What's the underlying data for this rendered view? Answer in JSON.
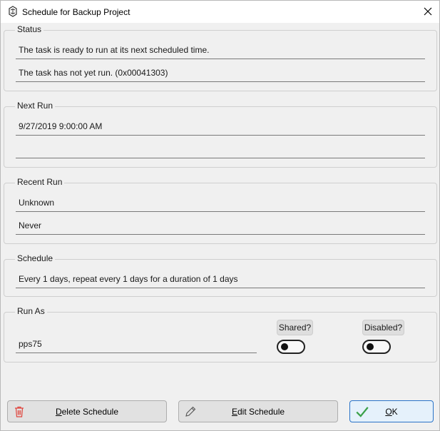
{
  "window": {
    "title": "Schedule for Backup Project"
  },
  "status": {
    "legend": "Status",
    "message": "The task is ready to run at its next scheduled time.",
    "result": "The task has not yet run. (0x00041303)"
  },
  "next_run": {
    "legend": "Next Run",
    "time": "9/27/2019 9:00:00 AM",
    "extra": ""
  },
  "recent_run": {
    "legend": "Recent Run",
    "result": "Unknown",
    "time": "Never"
  },
  "schedule": {
    "legend": "Schedule",
    "description": "Every 1 days, repeat every 1 days for a duration of 1 days"
  },
  "run_as": {
    "legend": "Run As",
    "user": "pps75",
    "shared_label": "Shared?",
    "shared_value": false,
    "disabled_label": "Disabled?",
    "disabled_value": false
  },
  "buttons": {
    "delete_prefix": "D",
    "delete_rest": "elete Schedule",
    "edit_prefix": "E",
    "edit_rest": "dit Schedule",
    "ok_prefix": "O",
    "ok_rest": "K"
  },
  "colors": {
    "delete_icon": "#e0443c",
    "ok_check": "#3aa048",
    "ok_border": "#2a73c8"
  }
}
